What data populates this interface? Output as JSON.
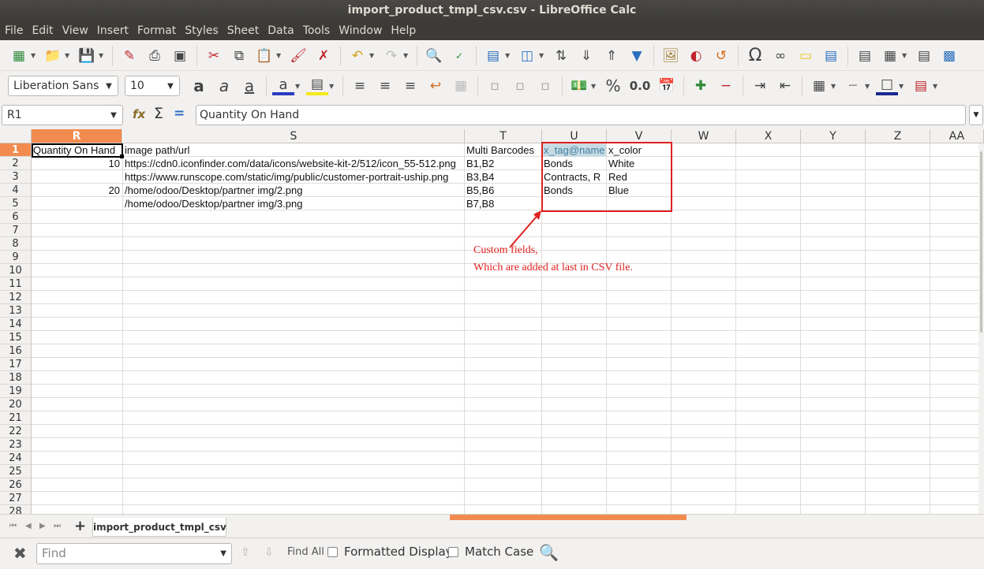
{
  "window": {
    "title": "import_product_tmpl_csv.csv - LibreOffice Calc"
  },
  "menu": [
    "File",
    "Edit",
    "View",
    "Insert",
    "Format",
    "Styles",
    "Sheet",
    "Data",
    "Tools",
    "Window",
    "Help"
  ],
  "toolbar2": {
    "font_name": "Liberation Sans",
    "font_size": "10",
    "number_format_percent": "%",
    "number_format_decimal": "0.0"
  },
  "formula_bar": {
    "name_box": "R1",
    "content": "Quantity On Hand"
  },
  "columns": [
    {
      "label": "R",
      "active": true
    },
    {
      "label": "S"
    },
    {
      "label": "T"
    },
    {
      "label": "U"
    },
    {
      "label": "V"
    },
    {
      "label": "W"
    },
    {
      "label": "X"
    },
    {
      "label": "Y"
    },
    {
      "label": "Z"
    },
    {
      "label": "AA"
    }
  ],
  "row_numbers": [
    "1",
    "2",
    "3",
    "4",
    "5",
    "6",
    "7",
    "8",
    "9",
    "10",
    "11",
    "12",
    "13",
    "14",
    "15",
    "16",
    "17",
    "18",
    "19",
    "20",
    "21",
    "22",
    "23",
    "24",
    "25",
    "26",
    "27",
    "28"
  ],
  "cells": {
    "R1": "Quantity On Hand",
    "S1": "image path/url",
    "T1": "Multi Barcodes",
    "U1": "x_tag@name",
    "V1": "x_color",
    "R2": "10",
    "S2": "https://cdn0.iconfinder.com/data/icons/website-kit-2/512/icon_55-512.png",
    "T2": "B1,B2",
    "U2": "Bonds",
    "V2": "White",
    "S3": "https://www.runscope.com/static/img/public/customer-portrait-uship.png",
    "T3": "B3,B4",
    "U3": "Contracts, R",
    "V3": "Red",
    "R4": "20",
    "S4": "/home/odoo/Desktop/partner img/2.png",
    "T4": "B5,B6",
    "U4": "Bonds",
    "V4": "Blue",
    "S5": "/home/odoo/Desktop/partner img/3.png",
    "T5": "B7,B8"
  },
  "annotation": {
    "line1": "Custom fields,",
    "line2": "Which are added at last in CSV file."
  },
  "sheet_tab": "import_product_tmpl_csv",
  "find_bar": {
    "placeholder": "Find",
    "find_all": "Find All",
    "formatted_display": "Formatted Display",
    "match_case": "Match Case"
  },
  "colors": {
    "accent": "#f28b4f",
    "annotation_red": "#e02020",
    "titlebar": "#3c3b37"
  }
}
